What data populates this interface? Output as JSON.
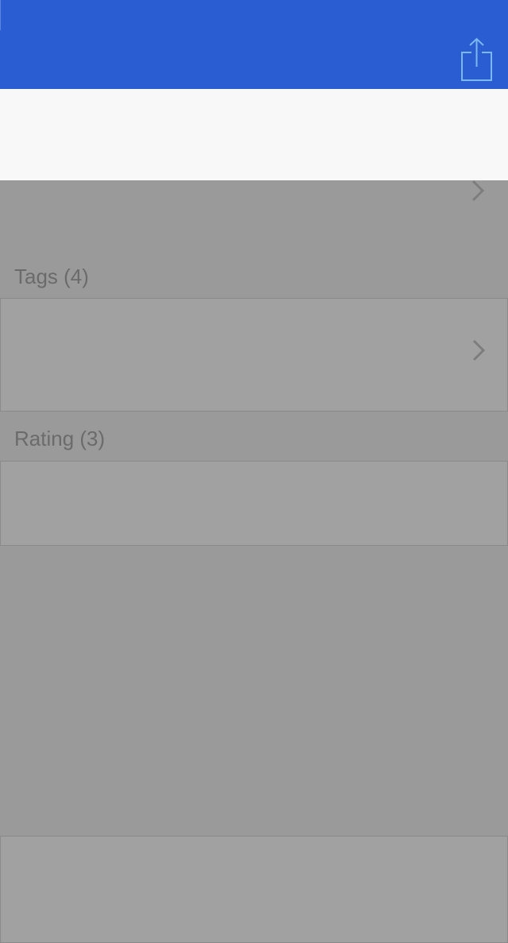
{
  "navbar": {
    "color": "#2a5dd1",
    "share_icon": "share-icon"
  },
  "sections": {
    "tags": {
      "label": "Tags (4)"
    },
    "rating": {
      "label": "Rating (3)"
    }
  },
  "icons": {
    "disclosure": "chevron-right-icon"
  }
}
